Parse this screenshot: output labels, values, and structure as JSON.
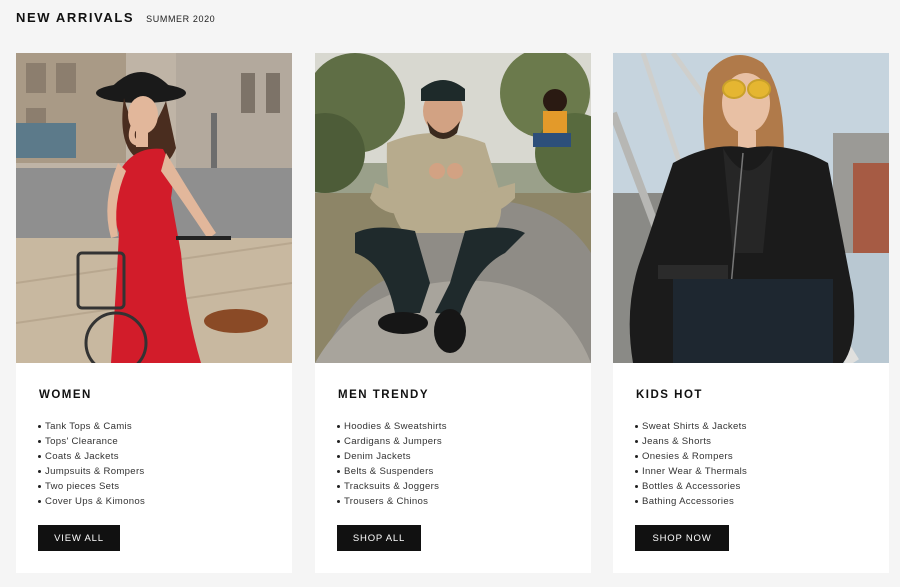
{
  "header": {
    "title": "NEW ARRIVALS",
    "subtitle": "SUMMER 2020"
  },
  "cards": [
    {
      "heading": "WOMEN",
      "items": [
        "Tank Tops & Camis",
        "Tops' Clearance",
        "Coats & Jackets",
        "Jumpsuits & Rompers",
        "Two pieces Sets",
        "Cover Ups & Kimonos"
      ],
      "button": "VIEW ALL"
    },
    {
      "heading": "MEN TRENDY",
      "items": [
        "Hoodies & Sweatshirts",
        "Cardigans & Jumpers",
        "Denim Jackets",
        "Belts & Suspenders",
        "Tracksuits & Joggers",
        "Trousers & Chinos"
      ],
      "button": "SHOP ALL"
    },
    {
      "heading": "KIDS HOT",
      "items": [
        "Sweat Shirts & Jackets",
        "Jeans & Shorts",
        "Onesies & Rompers",
        "Inner Wear & Thermals",
        "Bottles & Accessories",
        "Bathing Accessories"
      ],
      "button": "SHOP NOW"
    }
  ],
  "colors": {
    "background": "#f5f5f5",
    "card": "#ffffff",
    "button": "#111111",
    "button_text": "#ffffff"
  }
}
